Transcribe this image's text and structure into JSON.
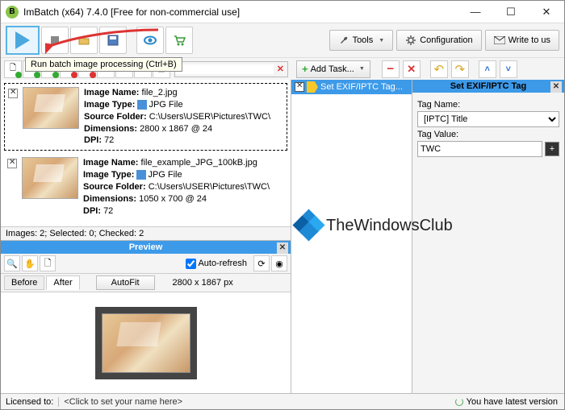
{
  "window": {
    "title": "ImBatch (x64) 7.4.0 [Free for non-commercial use]",
    "app_icon_letter": "B"
  },
  "toolbar": {
    "run_tooltip": "Run batch image processing (Ctrl+B)",
    "tools_label": "Tools",
    "config_label": "Configuration",
    "write_label": "Write to us"
  },
  "tasks_bar": {
    "add_label": "Add Task..."
  },
  "images": [
    {
      "name_label": "Image Name:",
      "name": "file_2.jpg",
      "type_label": "Image Type:",
      "type": "JPG File",
      "folder_label": "Source Folder:",
      "folder": "C:\\Users\\USER\\Pictures\\TWC\\",
      "dim_label": "Dimensions:",
      "dim": "2800 x 1867 @ 24",
      "dpi_label": "DPI:",
      "dpi": "72"
    },
    {
      "name_label": "Image Name:",
      "name": "file_example_JPG_100kB.jpg",
      "type_label": "Image Type:",
      "type": "JPG File",
      "folder_label": "Source Folder:",
      "folder": "C:\\Users\\USER\\Pictures\\TWC\\",
      "dim_label": "Dimensions:",
      "dim": "1050 x 700 @ 24",
      "dpi_label": "DPI:",
      "dpi": "72"
    }
  ],
  "image_status": "Images: 2; Selected: 0; Checked: 2",
  "preview": {
    "title": "Preview",
    "auto_refresh": "Auto-refresh",
    "before": "Before",
    "after": "After",
    "autofit": "AutoFit",
    "dims": "2800 x 1867 px"
  },
  "task_list": {
    "item": "Set EXIF/IPTC Tag..."
  },
  "props": {
    "title": "Set EXIF/IPTC Tag",
    "tagname_label": "Tag Name:",
    "tagname_value": "[IPTC] Title",
    "tagvalue_label": "Tag Value:",
    "tagvalue_value": "TWC"
  },
  "watermark": "TheWindowsClub",
  "status": {
    "lic_label": "Licensed to:",
    "lic_value": "<Click to set your name here>",
    "version": "You have latest version"
  }
}
